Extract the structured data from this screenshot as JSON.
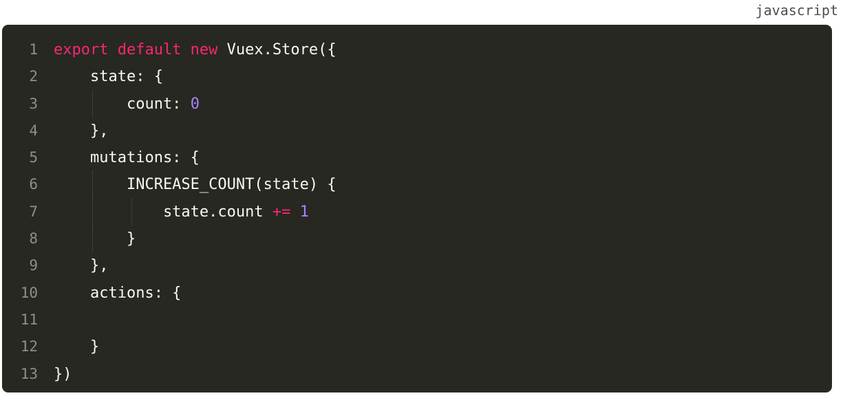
{
  "language_label": "javascript",
  "lines": [
    {
      "n": "1",
      "tokens": [
        {
          "t": "export default new",
          "c": "kw"
        },
        {
          "t": " Vuex.Store({",
          "c": "txt"
        }
      ]
    },
    {
      "n": "2",
      "tokens": [
        {
          "t": "    state: {",
          "c": "txt"
        }
      ]
    },
    {
      "n": "3",
      "tokens": [
        {
          "t": "        count: ",
          "c": "txt"
        },
        {
          "t": "0",
          "c": "num"
        }
      ]
    },
    {
      "n": "4",
      "tokens": [
        {
          "t": "    },",
          "c": "txt"
        }
      ]
    },
    {
      "n": "5",
      "tokens": [
        {
          "t": "    mutations: {",
          "c": "txt"
        }
      ]
    },
    {
      "n": "6",
      "tokens": [
        {
          "t": "        INCREASE_COUNT(state) {",
          "c": "txt"
        }
      ]
    },
    {
      "n": "7",
      "tokens": [
        {
          "t": "            state.count ",
          "c": "txt"
        },
        {
          "t": "+=",
          "c": "kw"
        },
        {
          "t": " ",
          "c": "txt"
        },
        {
          "t": "1",
          "c": "num"
        }
      ]
    },
    {
      "n": "8",
      "tokens": [
        {
          "t": "        }",
          "c": "txt"
        }
      ]
    },
    {
      "n": "9",
      "tokens": [
        {
          "t": "    },",
          "c": "txt"
        }
      ]
    },
    {
      "n": "10",
      "tokens": [
        {
          "t": "    actions: {",
          "c": "txt"
        }
      ]
    },
    {
      "n": "11",
      "tokens": []
    },
    {
      "n": "12",
      "tokens": [
        {
          "t": "    }",
          "c": "txt"
        }
      ]
    },
    {
      "n": "13",
      "tokens": [
        {
          "t": "})",
          "c": "txt"
        }
      ]
    }
  ],
  "colors": {
    "background": "#272822",
    "keyword": "#f92672",
    "number": "#ae81ff",
    "text": "#f8f8f2",
    "line_number": "#909088"
  }
}
